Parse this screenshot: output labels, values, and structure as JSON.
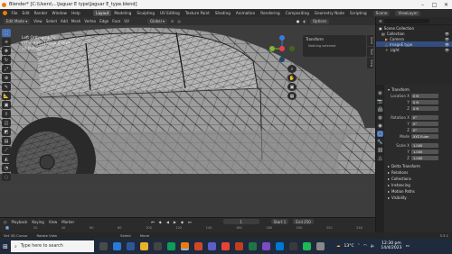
{
  "window": {
    "title": "Blender* [C:\\Users\\...\\Jaguar E type\\Jaguar E_type.blend]"
  },
  "menu": {
    "items": [
      "File",
      "Edit",
      "Render",
      "Window",
      "Help"
    ],
    "workspaces": [
      "Layout",
      "Modeling",
      "Sculpting",
      "UV Editing",
      "Texture Paint",
      "Shading",
      "Animation",
      "Rendering",
      "Compositing",
      "Geometry Node",
      "Scripting"
    ],
    "active_workspace": "Layout",
    "scene": "Scene",
    "view_layer": "ViewLayer"
  },
  "viewport_header": {
    "mode": "Edit Mode",
    "view": "View",
    "select": "Select",
    "add": "Add",
    "mesh": "Mesh",
    "vertex": "Vertex",
    "edge": "Edge",
    "face": "Face",
    "uv": "UV",
    "orientation": "Global",
    "options": "Options"
  },
  "viewport_info": {
    "projection": "Left Orthographic",
    "collection": "(1) Image | Jaguar E type",
    "units": "10 Meters"
  },
  "npanel": {
    "title": "Transform",
    "message": "Nothing selected",
    "tabs": [
      "Item",
      "Tool",
      "View"
    ]
  },
  "outliner": {
    "header": "Scene Collection",
    "rows": [
      {
        "label": "Collection",
        "icon": "collection-icon",
        "selected": false
      },
      {
        "label": "Camera",
        "icon": "camera-icon",
        "selected": false
      },
      {
        "label": "ImageE type",
        "icon": "mesh-icon",
        "selected": true
      },
      {
        "label": "Light",
        "icon": "light-icon",
        "selected": false
      }
    ]
  },
  "properties": {
    "section": "Transform",
    "location": {
      "label": "Location X",
      "x": "0 ft",
      "y": "0 ft",
      "z": "0 ft"
    },
    "rotation": {
      "label": "Rotation X",
      "x": "0°",
      "y": "0°",
      "z": "0°"
    },
    "mode": {
      "label": "Mode",
      "value": "XYZ Euler"
    },
    "scale": {
      "label": "Scale X",
      "x": "1.000",
      "y": "1.000",
      "z": "1.000"
    },
    "collapsed": [
      "Delta Transform",
      "Relations",
      "Collections",
      "Instancing",
      "Motion Paths",
      "Visibility"
    ]
  },
  "timeline": {
    "playback": "Playback",
    "keying": "Keying",
    "view": "View",
    "marker": "Marker",
    "current_frame": "1",
    "start_label": "Start",
    "start": "1",
    "end_label": "End",
    "end": "250",
    "ticks": [
      "0",
      "20",
      "40",
      "60",
      "80",
      "100",
      "120",
      "140",
      "160",
      "180",
      "200",
      "220",
      "240"
    ]
  },
  "statusbar": {
    "items": [
      "Set 3D Cursor",
      "Rotate View",
      "Select",
      "Move"
    ],
    "version": "3.3.1"
  },
  "taskbar": {
    "search_placeholder": "Type here to search",
    "weather": "13°C",
    "time": "12:30 pm",
    "date": "14/4/2023"
  },
  "colors": {
    "accent": "#4772b3",
    "x_axis": "#e8414d",
    "y_axis": "#7eba28",
    "z_axis": "#3d7bd9",
    "selected_row": "#334d80"
  }
}
